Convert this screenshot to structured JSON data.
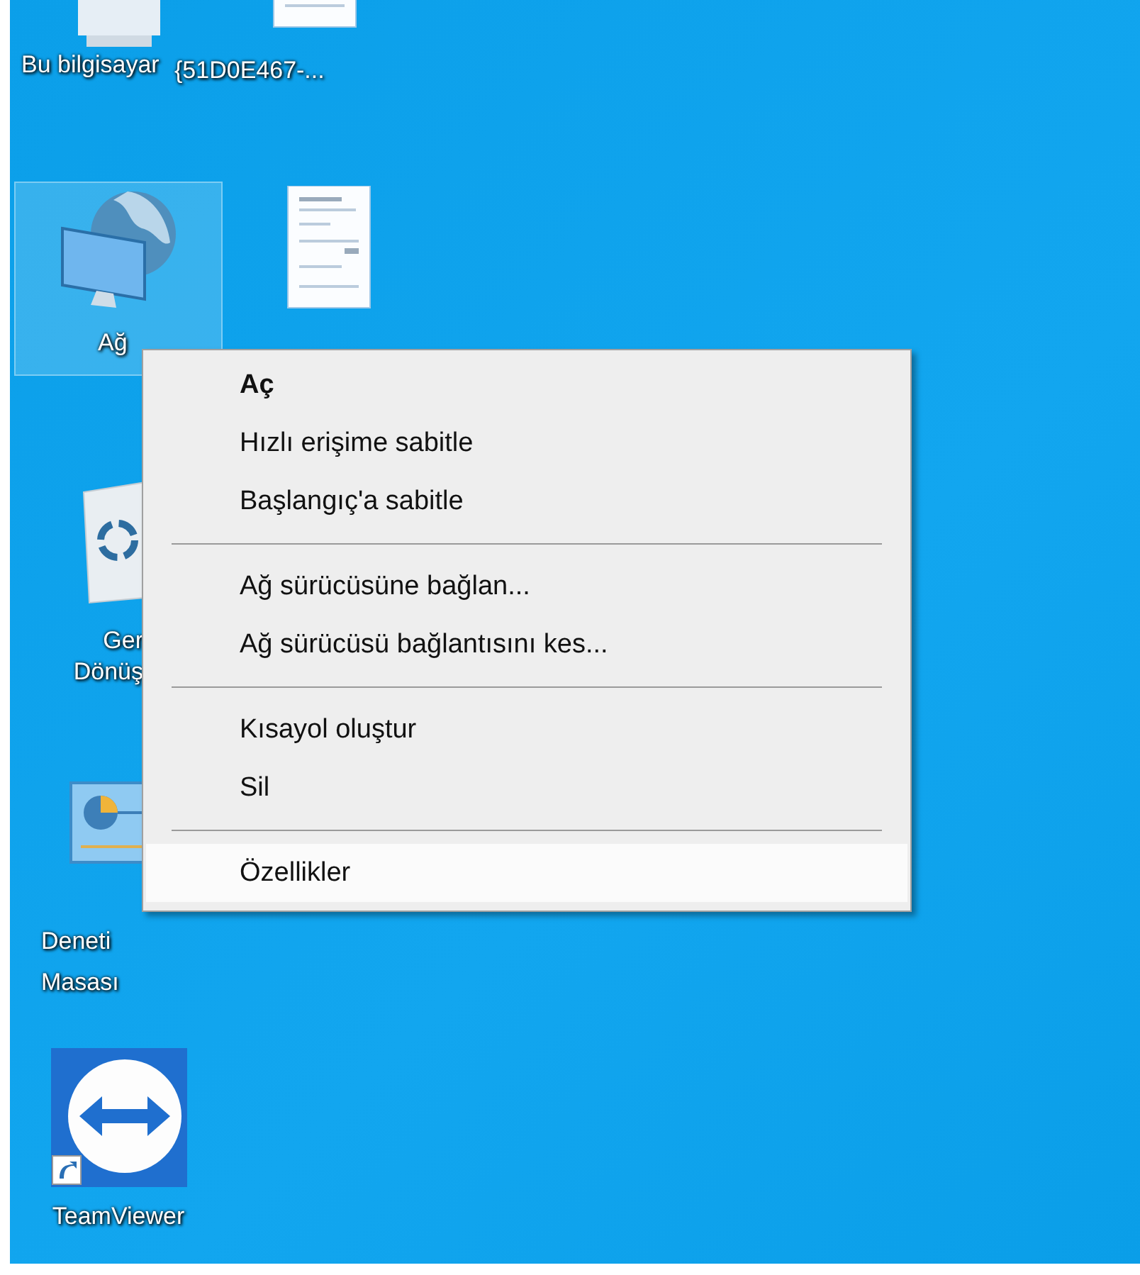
{
  "desktop_icons": [
    {
      "kind": "computer",
      "label_lines": [
        "Bu bilgisayar"
      ],
      "selected": false
    },
    {
      "kind": "document",
      "label_lines": [
        "{51D0E467-..."
      ],
      "selected": false
    },
    {
      "kind": "network",
      "label_lines": [
        "Ağ"
      ],
      "selected": true
    },
    {
      "kind": "document",
      "selected": false
    },
    {
      "kind": "recycle-bin",
      "label_lines": [
        "Ger",
        "Dönüş"
      ],
      "selected": false
    },
    {
      "kind": "control-panel",
      "label_lines": [
        "Deneti",
        "Masası"
      ],
      "selected": false
    },
    {
      "kind": "app-shortcut",
      "label_lines": [
        "TeamViewer"
      ],
      "selected": false
    }
  ],
  "context_menu": {
    "items": [
      {
        "kind": "item",
        "label": "Aç",
        "default": true,
        "selected": false
      },
      {
        "kind": "item",
        "label": "Hızlı erişime sabitle",
        "default": false,
        "selected": false
      },
      {
        "kind": "item",
        "label": "Başlangıç'a sabitle",
        "default": false,
        "selected": false
      },
      {
        "kind": "separator"
      },
      {
        "kind": "item",
        "label": "Ağ sürücüsüne bağlan...",
        "default": false,
        "selected": false
      },
      {
        "kind": "item",
        "label": "Ağ sürücüsü bağlantısını kes...",
        "default": false,
        "selected": false
      },
      {
        "kind": "separator"
      },
      {
        "kind": "item",
        "label": "Kısayol oluştur",
        "default": false,
        "selected": false
      },
      {
        "kind": "item",
        "label": "Sil",
        "default": false,
        "selected": false
      },
      {
        "kind": "separator"
      },
      {
        "kind": "item",
        "label": "Özellikler",
        "default": false,
        "selected": true
      }
    ]
  }
}
